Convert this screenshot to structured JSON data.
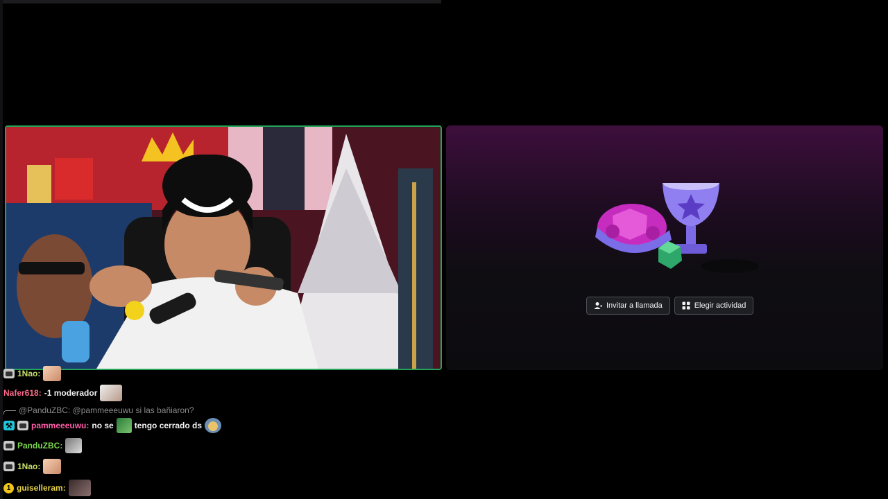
{
  "activity": {
    "buttons": [
      {
        "label": "Invitar a llamada",
        "icon": "person-add-icon"
      },
      {
        "label": "Elegir actividad",
        "icon": "apps-icon"
      }
    ]
  },
  "chat": {
    "messages": [
      {
        "user": "1Nao:",
        "color": "#c9e06a",
        "badge": "moderator-badge",
        "text": ""
      },
      {
        "user": "Nafer618:",
        "color": "#ff6b8a",
        "badge": "",
        "text": "-1 moderador"
      },
      {
        "reply_to": "@PanduZBC: @pammeeeuwu si las bañiaron?"
      },
      {
        "user": "pammeeeuwu:",
        "color": "#ff5ea8",
        "badge": "vip-badge",
        "text_before": "no se",
        "text_after": "tengo cerrado ds"
      },
      {
        "user": "PanduZBC:",
        "color": "#7dd94f",
        "badge": "moderator-badge",
        "text": ""
      },
      {
        "user": "1Nao:",
        "color": "#c9e06a",
        "badge": "moderator-badge",
        "text": ""
      },
      {
        "user": "guiselleram:",
        "color": "#e8d34a",
        "badge": "gold-badge",
        "badge_text": "1",
        "text": ""
      }
    ]
  },
  "colors": {
    "speaking_border": "#23a55a",
    "button_bg": "#1e1f22"
  }
}
